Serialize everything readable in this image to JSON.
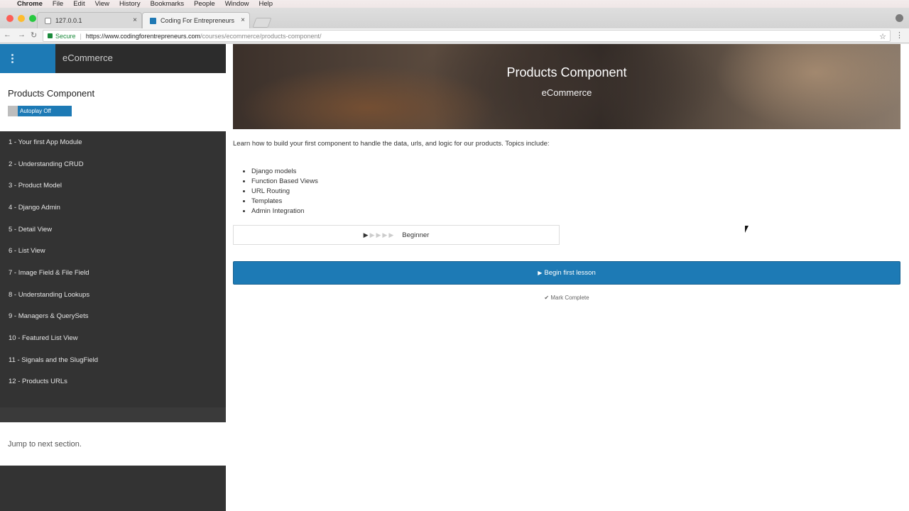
{
  "menubar": {
    "app": "Chrome",
    "items": [
      "File",
      "Edit",
      "View",
      "History",
      "Bookmarks",
      "People",
      "Window",
      "Help"
    ]
  },
  "tabs": [
    {
      "title": "127.0.0.1"
    },
    {
      "title": "Coding For Entrepreneurs"
    }
  ],
  "addressbar": {
    "secure_label": "Secure",
    "url_scheme_host": "https://www.codingforentrepreneurs.com",
    "url_path": "/courses/ecommerce/products-component/"
  },
  "sidebar": {
    "course": "eCommerce",
    "title": "Products Component",
    "autoplay_label": "Autoplay Off",
    "lessons": [
      "1 - Your first App Module",
      "2 - Understanding CRUD",
      "3 - Product Model",
      "4 - Django Admin",
      "5 - Detail View",
      "6 - List View",
      "7 - Image Field & File Field",
      "8 - Understanding Lookups",
      "9 - Managers & QuerySets",
      "10 - Featured List View",
      "11 - Signals and the SlugField",
      "12 - Products URLs"
    ],
    "next_section": "Jump to next section."
  },
  "hero": {
    "title": "Products Component",
    "subtitle": "eCommerce"
  },
  "content": {
    "description": "Learn how to build your first component to handle the data, urls, and logic for our products. Topics include:",
    "topics": [
      "Django models",
      "Function Based Views",
      "URL Routing",
      "Templates",
      "Admin Integration"
    ],
    "level": "Beginner",
    "level_value": 1,
    "level_max": 5,
    "begin_label": "Begin first lesson",
    "mark_complete_label": "Mark Complete"
  },
  "colors": {
    "accent": "#1d7ab5",
    "sidebar_bg": "#333333"
  }
}
